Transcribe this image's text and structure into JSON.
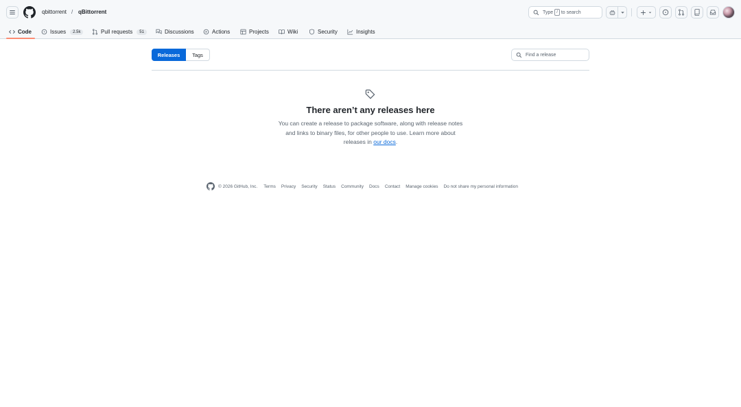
{
  "header": {
    "owner": "qbittorrent",
    "separator": "/",
    "repo": "qBittorrent",
    "search": {
      "before": "Type",
      "key": "/",
      "after": "to search"
    }
  },
  "repo_nav": {
    "items": [
      {
        "label": "Code",
        "icon": "code-icon",
        "active": true
      },
      {
        "label": "Issues",
        "icon": "issue-opened-icon",
        "count": "2.5k"
      },
      {
        "label": "Pull requests",
        "icon": "git-pull-request-icon",
        "count": "51"
      },
      {
        "label": "Discussions",
        "icon": "comment-discussion-icon"
      },
      {
        "label": "Actions",
        "icon": "play-icon"
      },
      {
        "label": "Projects",
        "icon": "table-icon"
      },
      {
        "label": "Wiki",
        "icon": "book-icon"
      },
      {
        "label": "Security",
        "icon": "shield-icon"
      },
      {
        "label": "Insights",
        "icon": "graph-icon"
      }
    ]
  },
  "subnav": {
    "releases_label": "Releases",
    "tags_label": "Tags",
    "find_placeholder": "Find a release"
  },
  "blankslate": {
    "icon": "tag-icon",
    "title": "There aren’t any releases here",
    "desc_before": "You can create a release to package software, along with release notes and links to binary files, for other people to use. Learn more about releases in ",
    "docs_link": "our docs",
    "desc_after": "."
  },
  "footer": {
    "copyright": "© 2026 GitHub, Inc.",
    "links": [
      "Terms",
      "Privacy",
      "Security",
      "Status",
      "Community",
      "Docs",
      "Contact",
      "Manage cookies",
      "Do not share my personal information"
    ]
  },
  "colors": {
    "accent": "#0969da",
    "active_underline": "#fd8c73",
    "header_bg": "#f6f8fa",
    "border": "#d1d9e0"
  }
}
